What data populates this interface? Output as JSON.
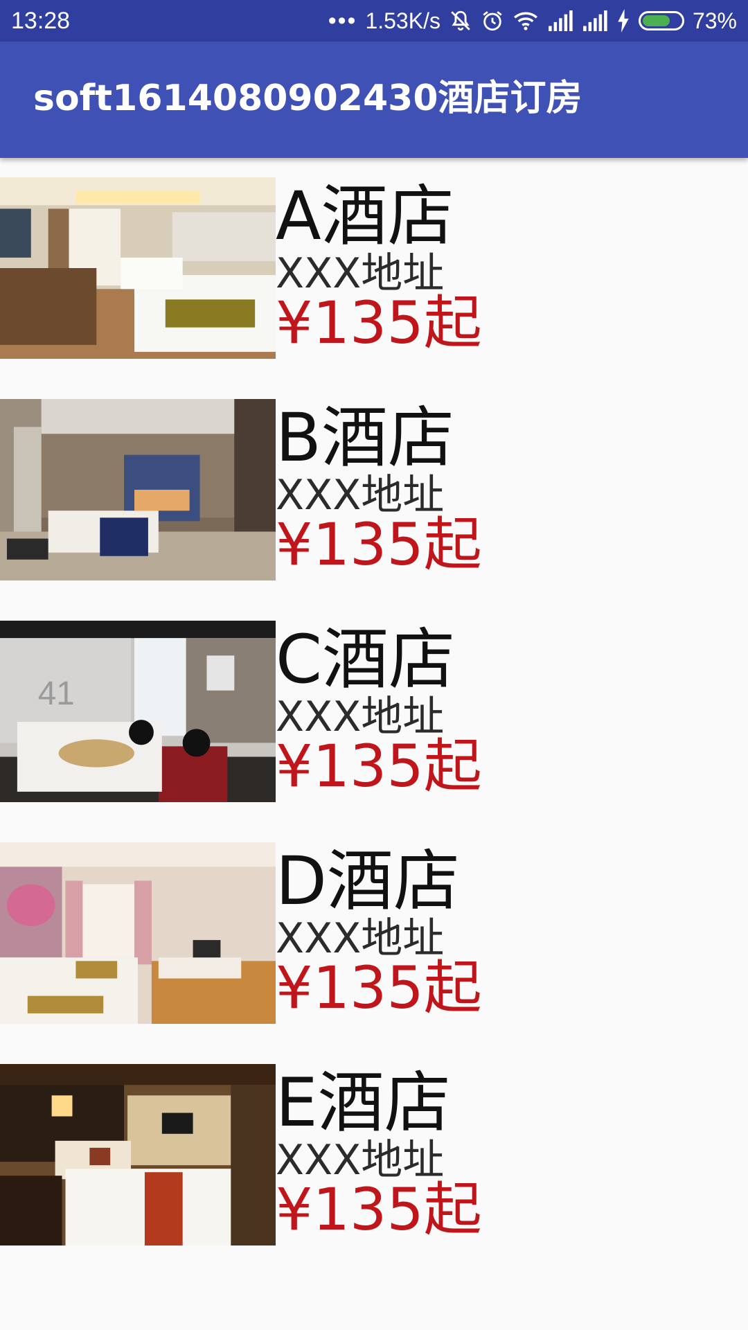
{
  "status_bar": {
    "time": "13:28",
    "dots": "•••",
    "net_speed": "1.53K/s",
    "icons": [
      "mute-icon",
      "alarm-icon",
      "wifi-icon",
      "signal-icon",
      "signal-icon",
      "charging-icon",
      "battery-icon"
    ],
    "battery_percent": "73%",
    "battery_level": 0.73,
    "battery_color": "#4caf50"
  },
  "app_bar": {
    "title": "soft1614080902430酒店订房",
    "color": "#3f51b5"
  },
  "hotels": [
    {
      "name": "A酒店",
      "address": "XXX地址",
      "price": "¥135起"
    },
    {
      "name": "B酒店",
      "address": "XXX地址",
      "price": "¥135起"
    },
    {
      "name": "C酒店",
      "address": "XXX地址",
      "price": "¥135起"
    },
    {
      "name": "D酒店",
      "address": "XXX地址",
      "price": "¥135起"
    },
    {
      "name": "E酒店",
      "address": "XXX地址",
      "price": "¥135起"
    }
  ],
  "price_color": "#c0161b"
}
